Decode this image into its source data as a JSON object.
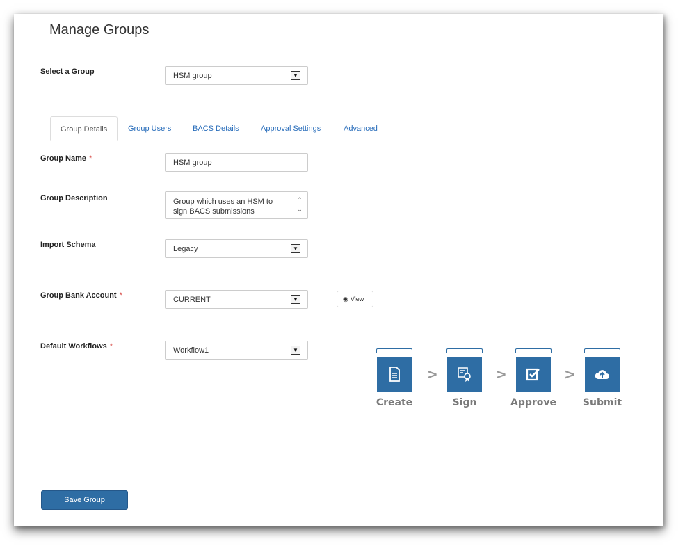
{
  "page_title": "Manage Groups",
  "select_group": {
    "label": "Select a Group",
    "value": "HSM group"
  },
  "tabs": [
    {
      "label": "Group Details",
      "active": true
    },
    {
      "label": "Group Users",
      "active": false
    },
    {
      "label": "BACS Details",
      "active": false
    },
    {
      "label": "Approval Settings",
      "active": false
    },
    {
      "label": "Advanced",
      "active": false
    }
  ],
  "form": {
    "group_name": {
      "label": "Group Name",
      "required_mark": "*",
      "value": "HSM group"
    },
    "group_description": {
      "label": "Group Description",
      "value": "Group which uses an HSM to sign BACS submissions"
    },
    "import_schema": {
      "label": "Import Schema",
      "value": "Legacy"
    },
    "group_bank_account": {
      "label": "Group Bank Account",
      "required_mark": "*",
      "value": "CURRENT",
      "view_button": "View"
    },
    "default_workflows": {
      "label": "Default Workflows",
      "required_mark": "*",
      "value": "Workflow1"
    }
  },
  "workflow": {
    "steps": [
      {
        "label": "Create",
        "icon": "document-icon"
      },
      {
        "label": "Sign",
        "icon": "certificate-icon"
      },
      {
        "label": "Approve",
        "icon": "approve-checkbox-icon"
      },
      {
        "label": "Submit",
        "icon": "cloud-upload-icon"
      }
    ],
    "separator": ">"
  },
  "save_button": "Save Group",
  "colors": {
    "primary": "#2e6da4",
    "link": "#2a6ebb",
    "required": "#d9534f",
    "step_label": "#7a7a7a"
  }
}
